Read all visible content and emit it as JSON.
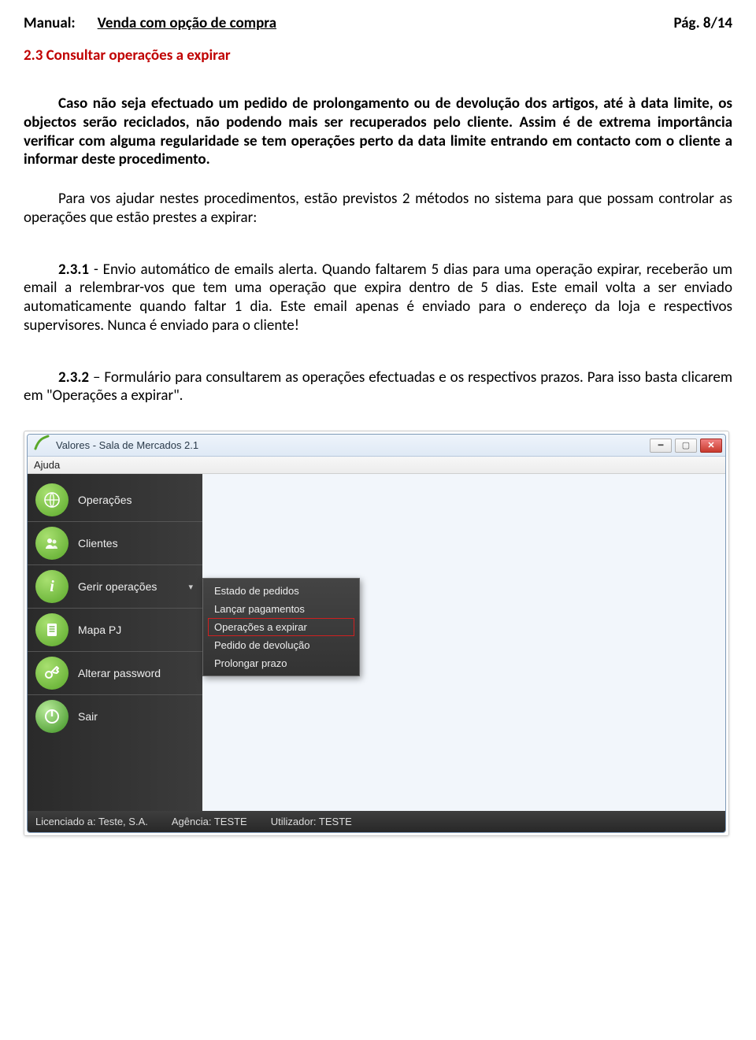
{
  "header": {
    "label": "Manual:",
    "title": "Venda com opção de compra",
    "page_ref": "Pág. 8/14"
  },
  "section_heading": "2.3 Consultar operações a expirar",
  "paragraphs": {
    "p1": "Caso não seja efectuado um pedido de prolongamento ou de devolução dos artigos, até à data limite, os objectos serão reciclados, não podendo mais ser recuperados pelo cliente. Assim é de extrema importância verificar com alguma regularidade se tem operações perto da data limite entrando em contacto com o cliente a informar deste procedimento.",
    "p2": "Para vos ajudar nestes procedimentos, estão previstos 2 métodos no sistema para que possam controlar as operações que estão prestes a expirar:",
    "p3_label": "2.3.1",
    "p3_body": " - Envio automático de emails alerta. Quando faltarem 5 dias para uma operação expirar, receberão um email a relembrar-vos que tem uma operação que expira dentro de 5 dias. Este email volta a ser enviado automaticamente quando faltar 1 dia. Este email apenas é enviado para o endereço da loja e respectivos supervisores. Nunca é enviado para o cliente!",
    "p4_label": "2.3.2",
    "p4_body": " – Formulário para consultarem as operações efectuadas e os respectivos prazos. Para isso basta clicarem em \"Operações a expirar\"."
  },
  "app": {
    "title": "Valores - Sala de Mercados 2.1",
    "menu_help": "Ajuda",
    "sidebar": [
      {
        "label": "Operações",
        "icon": "globe"
      },
      {
        "label": "Clientes",
        "icon": "users"
      },
      {
        "label": "Gerir operações",
        "icon": "info",
        "has_caret": true
      },
      {
        "label": "Mapa PJ",
        "icon": "doc"
      },
      {
        "label": "Alterar password",
        "icon": "key"
      },
      {
        "label": "Sair",
        "icon": "power"
      }
    ],
    "submenu": [
      "Estado de pedidos",
      "Lançar pagamentos",
      "Operações a expirar",
      "Pedido de devolução",
      "Prolongar prazo"
    ],
    "status": {
      "licenciado": "Licenciado a:  Teste, S.A.",
      "agencia": "Agência:  TESTE",
      "utilizador": "Utilizador:  TESTE"
    }
  }
}
